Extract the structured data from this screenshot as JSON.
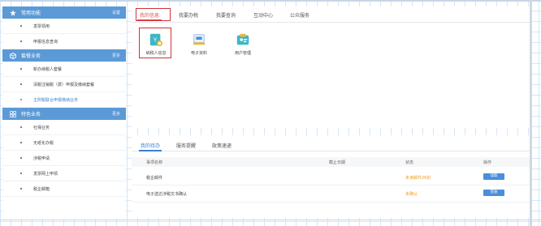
{
  "sidebar": {
    "sections": [
      {
        "title": "常用功能",
        "more": "设置",
        "icon": "star-icon",
        "items": [
          {
            "label": "发票领用"
          },
          {
            "label": "申报信息查询"
          }
        ]
      },
      {
        "title": "套餐业务",
        "more": "更多",
        "icon": "package-icon",
        "items": [
          {
            "label": "新办纳税人套餐"
          },
          {
            "label": "清税注销税（费）申报及缴纳套餐"
          },
          {
            "label": "主附税联合申报缴纳业务",
            "active": true
          }
        ]
      },
      {
        "title": "特色业务",
        "more": "更多",
        "icon": "grid-icon",
        "items": [
          {
            "label": "社保业务"
          },
          {
            "label": "无纸化办税"
          },
          {
            "label": "涉税申请"
          },
          {
            "label": "发票网上申领"
          },
          {
            "label": "税企邮箱"
          }
        ]
      }
    ]
  },
  "top_tabs": [
    "我的信息",
    "我要办税",
    "我要查询",
    "互动中心",
    "公众服务"
  ],
  "tiles": [
    {
      "label": "纳税人信息",
      "icon": "taxpayer-info-icon"
    },
    {
      "label": "电子资料",
      "icon": "electronic-docs-icon"
    },
    {
      "label": "用户管理",
      "icon": "user-management-icon"
    }
  ],
  "bottom_tabs": [
    "我的待办",
    "服务提醒",
    "政策速递"
  ],
  "todo_table": {
    "headers": [
      "事项名称",
      "截止日期",
      "状态",
      "操作"
    ],
    "rows": [
      {
        "name": "税企邮件",
        "deadline": "",
        "status": "未读邮件26封",
        "action": "读取"
      },
      {
        "name": "电子送达涉税文书确认",
        "deadline": "",
        "status": "未确认",
        "action": "签收"
      }
    ]
  },
  "colors": {
    "sidebar_header": "#5b9ad6",
    "active_tab_red": "#d9534f",
    "highlight_box": "#d0333a",
    "link_blue": "#3a7fce",
    "status_orange": "#f0a020",
    "button_blue": "#4a8fd9"
  }
}
